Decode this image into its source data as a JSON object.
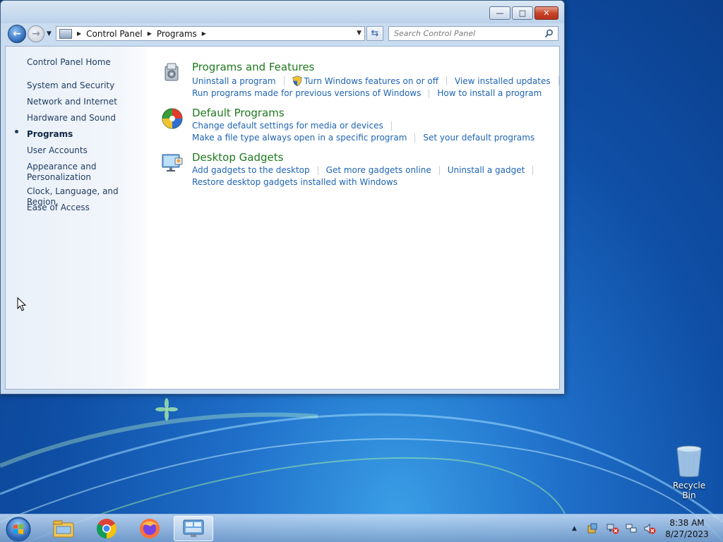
{
  "window": {
    "breadcrumb": [
      "Control Panel",
      "Programs"
    ],
    "search_placeholder": "Search Control Panel",
    "caption_buttons": {
      "minimize": "—",
      "maximize": "□",
      "close": "✕"
    }
  },
  "sidebar": {
    "items": [
      {
        "label": "Control Panel Home"
      },
      {
        "label": "System and Security"
      },
      {
        "label": "Network and Internet"
      },
      {
        "label": "Hardware and Sound"
      },
      {
        "label": "Programs",
        "active": true
      },
      {
        "label": "User Accounts"
      },
      {
        "label": "Appearance and Personalization"
      },
      {
        "label": "Clock, Language, and Region"
      },
      {
        "label": "Ease of Access"
      }
    ]
  },
  "main": {
    "categories": [
      {
        "title": "Programs and Features",
        "icon": "programs-features-icon",
        "rows": [
          [
            "Uninstall a program",
            "Turn Windows features on or off",
            "View installed updates"
          ],
          [
            "Run programs made for previous versions of Windows",
            "How to install a program"
          ]
        ]
      },
      {
        "title": "Default Programs",
        "icon": "default-programs-icon",
        "rows": [
          [
            "Change default settings for media or devices"
          ],
          [
            "Make a file type always open in a specific program",
            "Set your default programs"
          ]
        ]
      },
      {
        "title": "Desktop Gadgets",
        "icon": "desktop-gadgets-icon",
        "rows": [
          [
            "Add gadgets to the desktop",
            "Get more gadgets online",
            "Uninstall a gadget"
          ],
          [
            "Restore desktop gadgets installed with Windows"
          ]
        ]
      }
    ]
  },
  "desktop": {
    "recycle_bin_label": "Recycle Bin"
  },
  "taskbar": {
    "time": "8:38 AM",
    "date": "8/27/2023",
    "apps": [
      "file-explorer-icon",
      "chrome-icon",
      "firefox-icon",
      "control-panel-icon"
    ]
  },
  "colors": {
    "category_title": "#1e7a1e",
    "task_link": "#1e64b4",
    "sidebar_text": "#1e3a5f"
  }
}
